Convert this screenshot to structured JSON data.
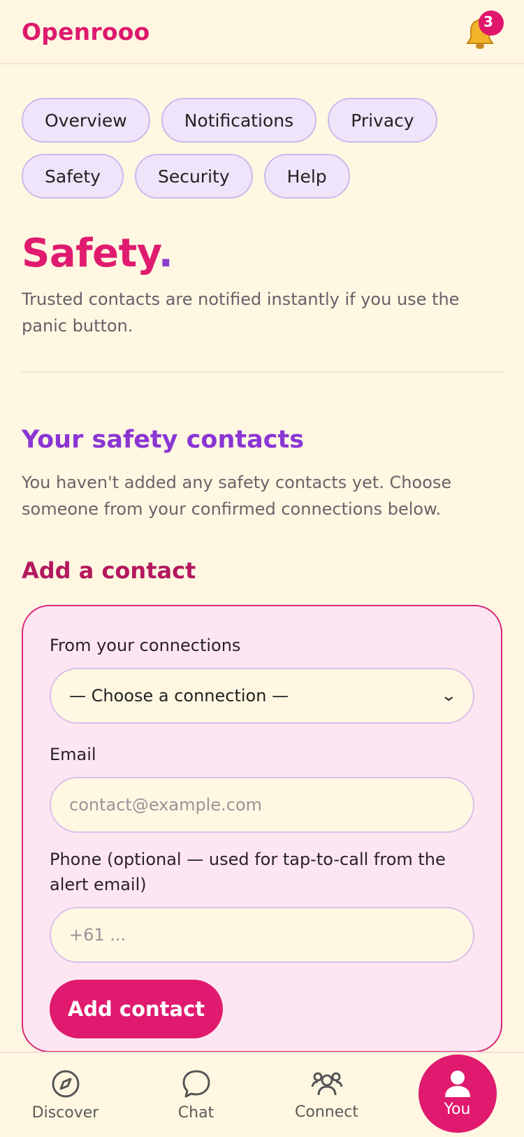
{
  "header": {
    "brand": "Openrooo",
    "notification_count": "3",
    "bell_icon": "bell-icon"
  },
  "tabs": [
    {
      "label": "Overview"
    },
    {
      "label": "Notifications"
    },
    {
      "label": "Privacy"
    },
    {
      "label": "Safety"
    },
    {
      "label": "Security"
    },
    {
      "label": "Help"
    }
  ],
  "page": {
    "title": "Safety",
    "title_dot": ".",
    "lead": "Trusted contacts are notified instantly if you use the panic button."
  },
  "contacts": {
    "heading": "Your safety contacts",
    "empty_text": "You haven't added any safety contacts yet. Choose someone from your confirmed connections below."
  },
  "add_contact": {
    "heading": "Add a contact",
    "connections_label": "From your connections",
    "connections_selected": "— Choose a connection —",
    "email_label": "Email",
    "email_placeholder": "contact@example.com",
    "phone_label": "Phone (optional — used for tap-to-call from the alert email)",
    "phone_placeholder": "+61 ...",
    "submit_label": "Add contact"
  },
  "bottom_nav": [
    {
      "label": "Discover",
      "icon": "compass-icon"
    },
    {
      "label": "Chat",
      "icon": "chat-bubble-icon"
    },
    {
      "label": "Connect",
      "icon": "people-icon"
    },
    {
      "label": "You",
      "icon": "user-icon",
      "active": true
    }
  ],
  "colors": {
    "accent": "#e01a6e",
    "secondary": "#8a35d4",
    "background": "#fff7e2"
  }
}
